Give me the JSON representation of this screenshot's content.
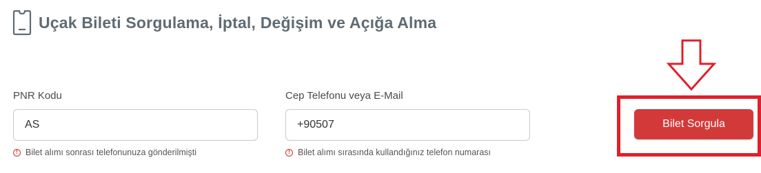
{
  "header": {
    "title": "Uçak Bileti Sorgulama, İptal, Değişim ve Açığa Alma",
    "icon": "ticket-icon"
  },
  "form": {
    "pnr": {
      "label": "PNR Kodu",
      "value": "AS",
      "hint": "Bilet alımı sonrası telefonunuza gönderilmişti"
    },
    "contact": {
      "label": "Cep Telefonu veya E-Mail",
      "value": "+90507",
      "hint": "Bilet alımı sırasında kullandığınız telefon numarası"
    },
    "submit_label": "Bilet Sorgula"
  },
  "annotation": {
    "arrow_icon": "down-arrow-icon",
    "box_color": "#e0202a"
  },
  "colors": {
    "accent": "#d23a3a",
    "title": "#5f6b73"
  }
}
